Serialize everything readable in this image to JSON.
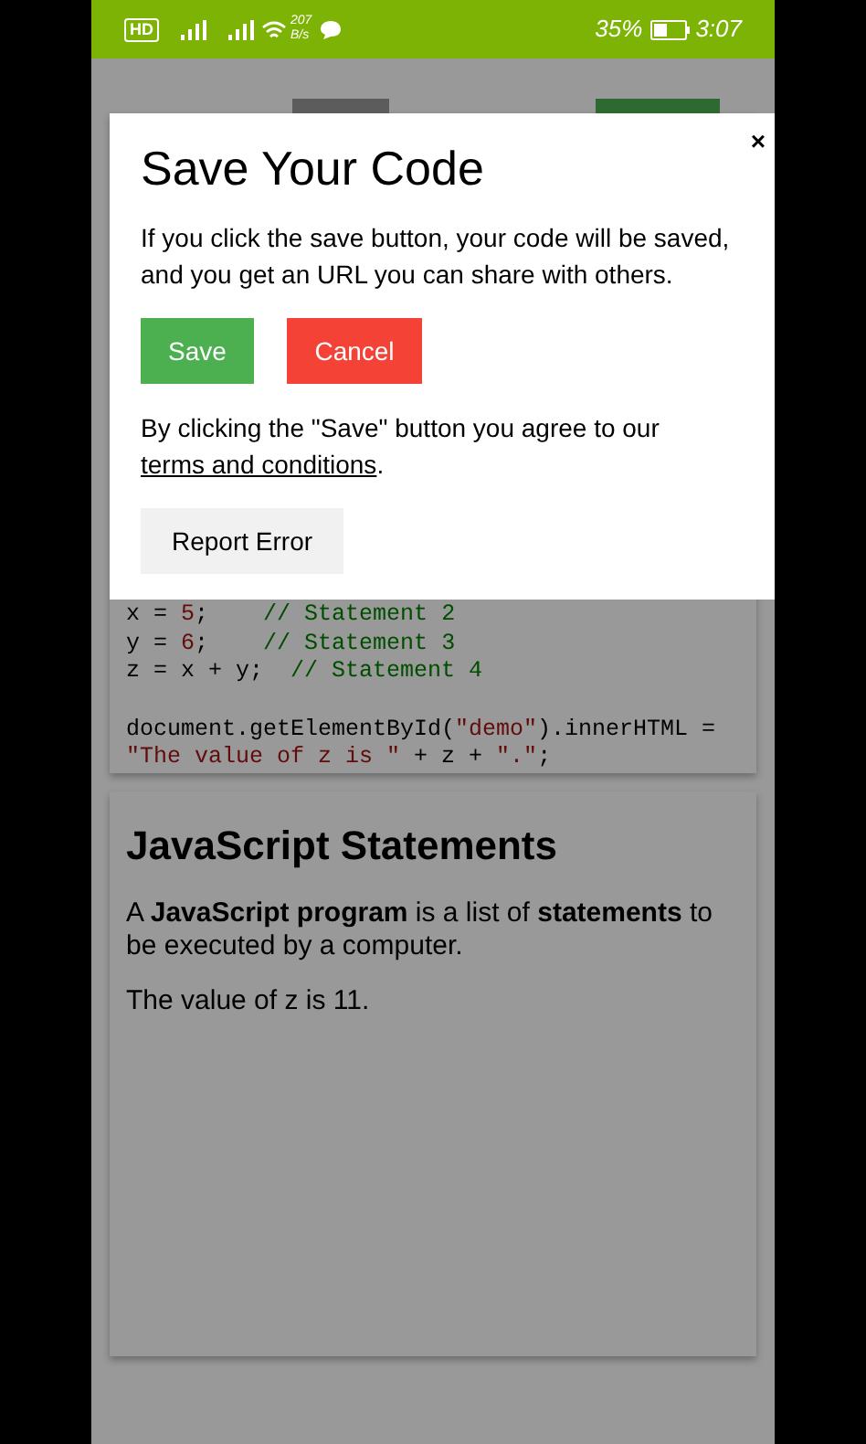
{
  "status_bar": {
    "network_badge": "HD",
    "speed_value": "207",
    "speed_unit": "B/s",
    "battery": "35%",
    "time": "3:07"
  },
  "code": [
    {
      "tokens": [
        {
          "kind": "plain",
          "text": "x = "
        },
        {
          "kind": "number",
          "text": "5"
        },
        {
          "kind": "plain",
          "text": ";    "
        },
        {
          "kind": "comment",
          "text": "// Statement 2"
        }
      ]
    },
    {
      "tokens": [
        {
          "kind": "plain",
          "text": "y = "
        },
        {
          "kind": "number",
          "text": "6"
        },
        {
          "kind": "plain",
          "text": ";    "
        },
        {
          "kind": "comment",
          "text": "// Statement 3"
        }
      ]
    },
    {
      "tokens": [
        {
          "kind": "plain",
          "text": "z = x + y;  "
        },
        {
          "kind": "comment",
          "text": "// Statement 4"
        }
      ]
    },
    {
      "gap_before": true,
      "tokens": [
        {
          "kind": "plain",
          "text": "document.getElementById("
        },
        {
          "kind": "string",
          "text": "\"demo\""
        },
        {
          "kind": "plain",
          "text": ").innerHTML ="
        }
      ]
    },
    {
      "tokens": [
        {
          "kind": "string",
          "text": "\"The value of z is \""
        },
        {
          "kind": "plain",
          "text": " + z + "
        },
        {
          "kind": "string",
          "text": "\".\""
        },
        {
          "kind": "plain",
          "text": ";"
        }
      ]
    }
  ],
  "result": {
    "heading": "JavaScript Statements",
    "paragraphs": [
      "A **JavaScript program** is a list of **statements** to be executed by a computer.",
      "The value of z is 11."
    ]
  },
  "modal": {
    "title": "Save Your Code",
    "close": "×",
    "message": "If you click the save button, your code will be saved, and you get an URL you can share with others.",
    "buttons": [
      {
        "label": "Save",
        "kind": "primary"
      },
      {
        "label": "Cancel",
        "kind": "danger"
      }
    ],
    "terms_prefix": "By clicking the \"Save\" button you agree to our ",
    "terms_link": "terms and conditions",
    "terms_suffix": ".",
    "report_button": "Report Error"
  }
}
